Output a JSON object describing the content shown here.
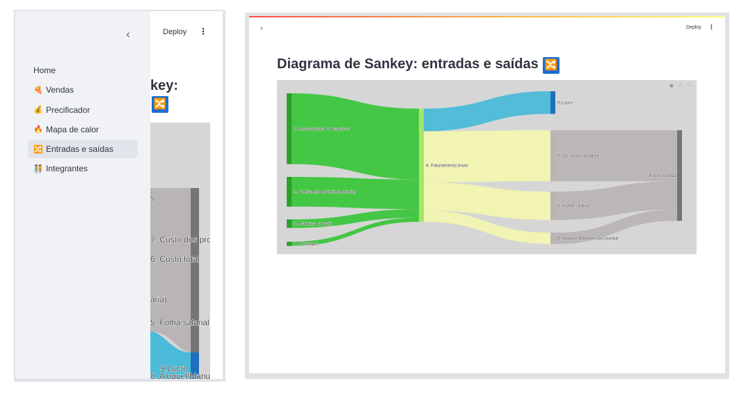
{
  "left_window": {
    "sidebar": {
      "collapse_icon": "chevron-left-icon",
      "collapse_glyph": "‹",
      "items": [
        {
          "label": "Home",
          "icon": "",
          "active": false
        },
        {
          "label": "Vendas",
          "icon": "pizza-icon",
          "glyph": "🍕",
          "active": false
        },
        {
          "label": "Precificador",
          "icon": "money-bag-icon",
          "glyph": "💰",
          "active": false
        },
        {
          "label": "Mapa de calor",
          "icon": "fire-icon",
          "glyph": "🔥",
          "active": false
        },
        {
          "label": "Entradas e saídas",
          "icon": "shuffle-icon",
          "glyph": "🔀",
          "active": true
        },
        {
          "label": "Integrantes",
          "icon": "people-icon",
          "glyph": "🧑‍🤝‍🧑",
          "active": false
        }
      ]
    },
    "header": {
      "deploy_label": "Deploy",
      "menu_glyph": "⋮"
    },
    "title_fragment": "key:",
    "title_icon_glyph": "🔀",
    "chart_labels": [
      "s",
      "7. Custo dos pro",
      "6. Custo total",
      "aria)",
      "5. Folha salarial",
      "9.Lucro",
      "8. Aluguel/Manu"
    ]
  },
  "right_window": {
    "expand_glyph": "›",
    "header": {
      "deploy_label": "Deploy",
      "menu_glyph": "⋮"
    },
    "title": "Diagrama de Sankey: entradas e saídas",
    "title_icon_glyph": "🔀",
    "modebar": [
      {
        "name": "camera-icon",
        "glyph": "◉"
      },
      {
        "name": "home-icon",
        "glyph": "⌂"
      },
      {
        "name": "fullscreen-icon",
        "glyph": "⛶"
      }
    ],
    "colors": {
      "source_green": "#3cc63c",
      "source_dark": "#2ca02c",
      "faturamento": "#a6e46a",
      "lucro": "#4bbbd9",
      "custos_flow": "#f2f5b0",
      "custo_total_flow": "#b9b5b5",
      "custo_total_node": "#757575",
      "lucro_node": "#1f6fbf",
      "background": "#d6d6d6"
    },
    "chart_data": {
      "type": "sankey",
      "nodes": [
        "0. Mercadorias de Terceiros",
        "1. Recargas",
        "2. Fabricação própria (Padaria)",
        "3. Máquina de café",
        "4. Faturamento bruto",
        "5. Folha salarial",
        "6. Custo total",
        "7. Custo dos produtos",
        "8. Aluguel/Manutenção predial",
        "9.Lucro"
      ],
      "links": [
        {
          "source": "0. Mercadorias de Terceiros",
          "target": "4. Faturamento bruto",
          "value": 100
        },
        {
          "source": "2. Fabricação própria (Padaria)",
          "target": "4. Faturamento bruto",
          "value": 42
        },
        {
          "source": "3. Máquina de café",
          "target": "4. Faturamento bruto",
          "value": 12
        },
        {
          "source": "1. Recargas",
          "target": "4. Faturamento bruto",
          "value": 6
        },
        {
          "source": "4. Faturamento bruto",
          "target": "9.Lucro",
          "value": 32
        },
        {
          "source": "4. Faturamento bruto",
          "target": "7. Custo dos produtos",
          "value": 72
        },
        {
          "source": "4. Faturamento bruto",
          "target": "5. Folha salarial",
          "value": 40
        },
        {
          "source": "4. Faturamento bruto",
          "target": "8. Aluguel/Manutenção predial",
          "value": 16
        },
        {
          "source": "7. Custo dos produtos",
          "target": "6. Custo total",
          "value": 72
        },
        {
          "source": "5. Folha salarial",
          "target": "6. Custo total",
          "value": 40
        },
        {
          "source": "8. Aluguel/Manutenção predial",
          "target": "6. Custo total",
          "value": 16
        }
      ]
    }
  }
}
